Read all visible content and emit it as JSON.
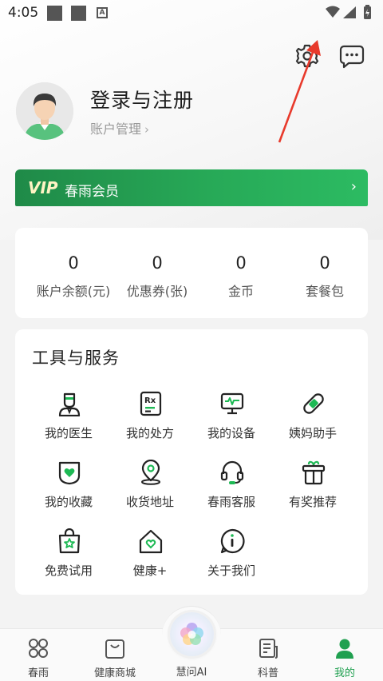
{
  "status_bar": {
    "time": "4:05"
  },
  "header": {
    "settings_icon": "gear-icon",
    "message_icon": "chat-bubble-icon"
  },
  "profile": {
    "title": "登录与注册",
    "account_link": "账户管理",
    "chevron": "›"
  },
  "vip": {
    "badge": "VIP",
    "label": "春雨会员",
    "chevron": "›",
    "colors": {
      "start": "#1f8a48",
      "end": "#2cbb62"
    }
  },
  "stats": [
    {
      "value": "0",
      "label": "账户余额(元)"
    },
    {
      "value": "0",
      "label": "优惠券(张)"
    },
    {
      "value": "0",
      "label": "金币"
    },
    {
      "value": "0",
      "label": "套餐包"
    }
  ],
  "tools": {
    "title": "工具与服务",
    "items": [
      {
        "label": "我的医生",
        "icon": "doctor-icon"
      },
      {
        "label": "我的处方",
        "icon": "prescription-icon"
      },
      {
        "label": "我的设备",
        "icon": "monitor-device-icon"
      },
      {
        "label": "姨妈助手",
        "icon": "bandage-icon"
      },
      {
        "label": "我的收藏",
        "icon": "favorite-heart-icon"
      },
      {
        "label": "收货地址",
        "icon": "location-pin-icon"
      },
      {
        "label": "春雨客服",
        "icon": "headset-icon"
      },
      {
        "label": "有奖推荐",
        "icon": "gift-icon"
      },
      {
        "label": "免费试用",
        "icon": "shopping-bag-star-icon"
      },
      {
        "label": "健康+",
        "icon": "house-heart-icon"
      },
      {
        "label": "关于我们",
        "icon": "info-icon"
      }
    ]
  },
  "bottom_nav": {
    "items": [
      {
        "label": "春雨",
        "icon": "home-grid-icon"
      },
      {
        "label": "健康商城",
        "icon": "shop-bag-icon"
      },
      {
        "label": "慧问AI",
        "icon": "ai-orb-icon"
      },
      {
        "label": "科普",
        "icon": "article-icon"
      },
      {
        "label": "我的",
        "icon": "person-icon"
      }
    ],
    "active_index": 4,
    "active_color": "#20a050"
  },
  "accent_color": "#1db954",
  "annotation_color": "#e83a2c"
}
